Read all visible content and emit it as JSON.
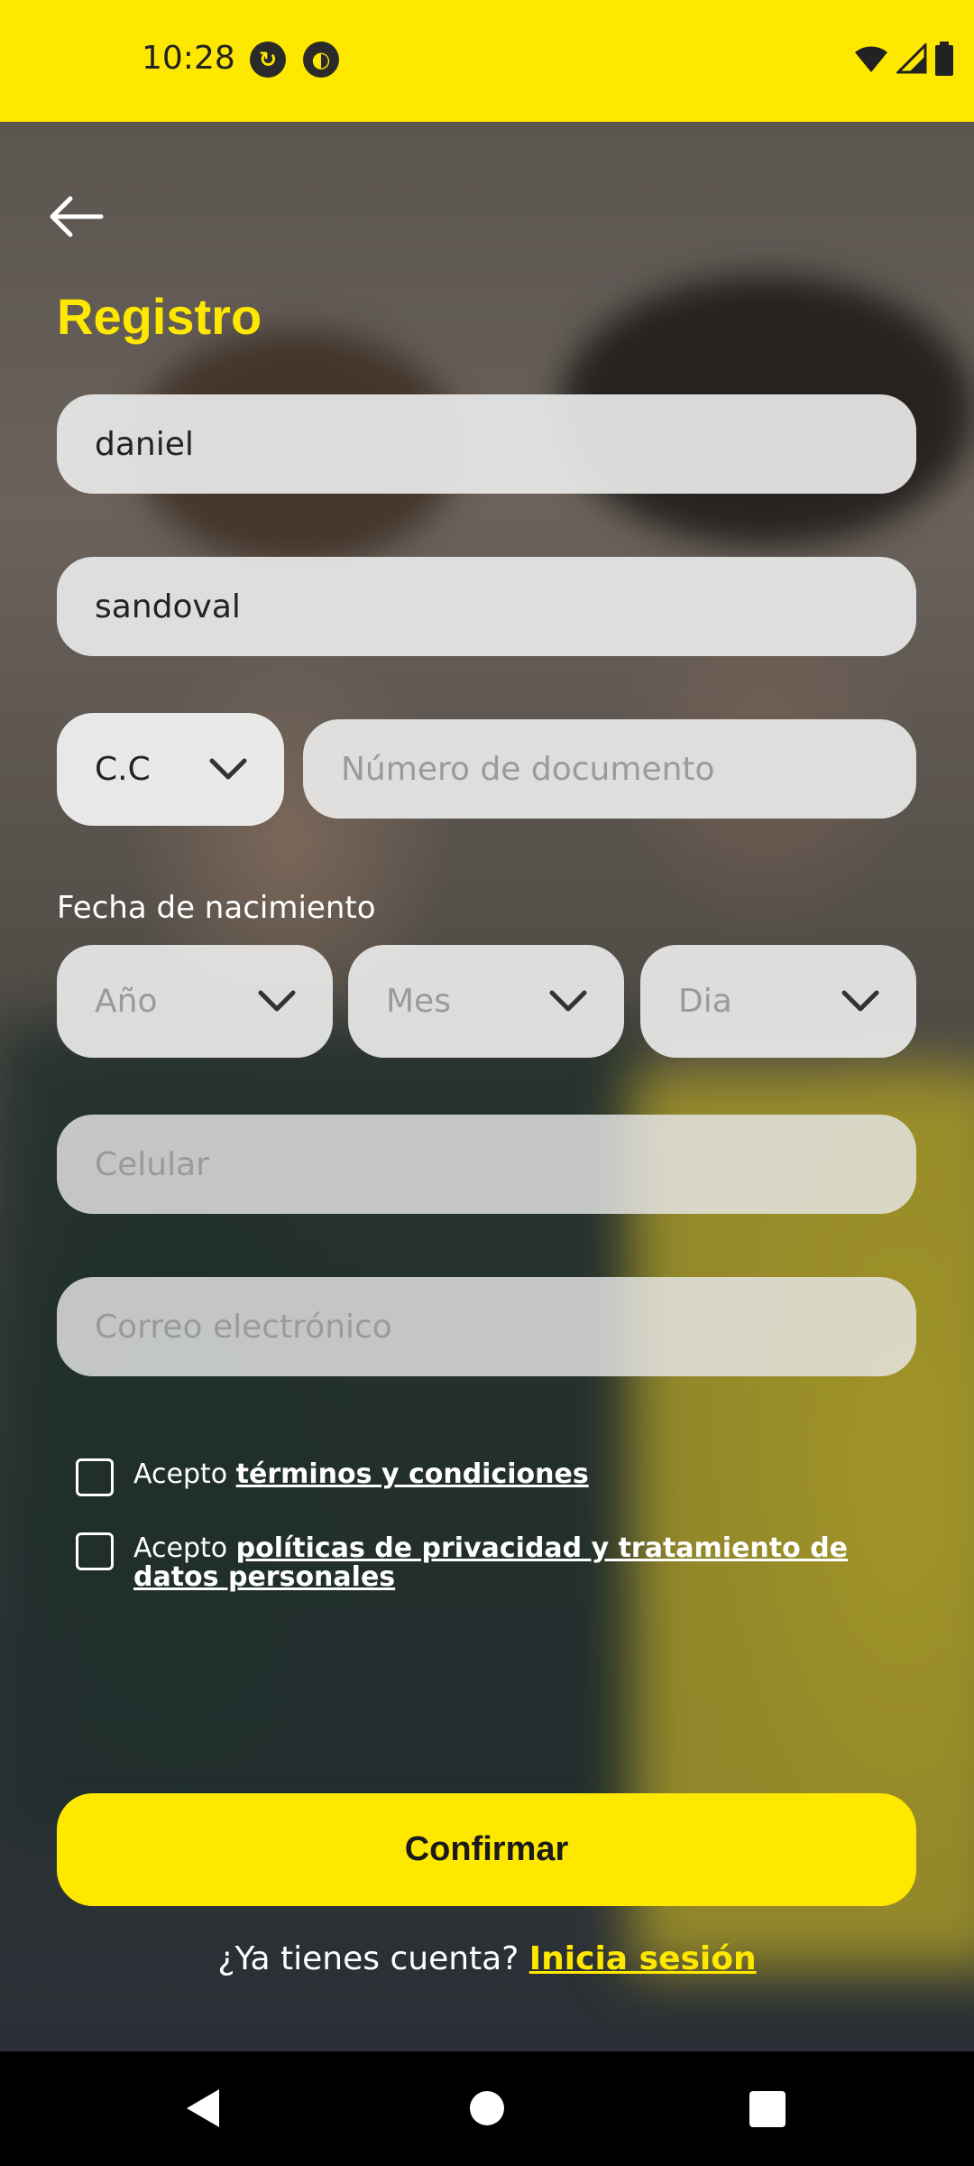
{
  "status_bar": {
    "time": "10:28"
  },
  "header": {
    "title": "Registro"
  },
  "form": {
    "first_name_value": "daniel",
    "last_name_value": "sandoval",
    "doc_type_value": "C.C",
    "doc_number_placeholder": "Número de documento",
    "dob_label": "Fecha de nacimiento",
    "year_placeholder": "Año",
    "month_placeholder": "Mes",
    "day_placeholder": "Dia",
    "phone_placeholder": "Celular",
    "email_placeholder": "Correo electrónico"
  },
  "consents": {
    "terms_prefix": "Acepto ",
    "terms_link": "términos y condiciones",
    "privacy_prefix": "Acepto ",
    "privacy_link": "políticas de privacidad y tratamiento de datos personales"
  },
  "actions": {
    "confirm_label": "Confirmar",
    "login_prompt": "¿Ya tienes cuenta? ",
    "login_link": "Inicia sesión"
  },
  "colors": {
    "accent": "#FFE800",
    "field_bg": "#E8E8E8",
    "nav_bg": "#000000"
  },
  "icons": [
    "back-arrow-icon",
    "chevron-down-icon",
    "wifi-icon",
    "signal-icon",
    "battery-icon"
  ]
}
